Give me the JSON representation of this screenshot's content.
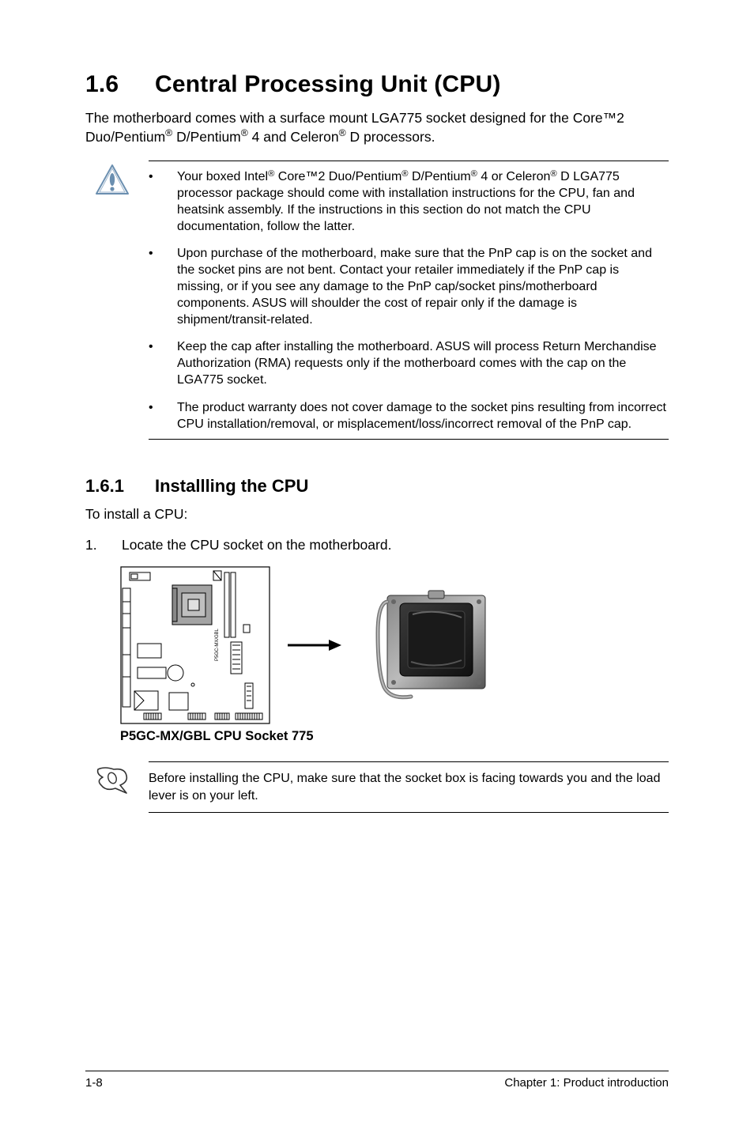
{
  "section": {
    "number": "1.6",
    "title": "Central Processing Unit (CPU)"
  },
  "intro_parts": {
    "p1": "The motherboard comes with a surface mount LGA775 socket designed for the Core™2 Duo/Pentium",
    "p2": " D/Pentium",
    "p3": " 4 and Celeron",
    "p4": " D processors."
  },
  "caution_bullets": [
    {
      "t1": "Your boxed Intel",
      "t2": " Core™2 Duo/Pentium",
      "t3": " D/Pentium",
      "t4": " 4 or Celeron",
      "t5": " D LGA775 processor package should come with installation instructions for the CPU, fan and heatsink assembly. If the instructions in this section do not match the CPU documentation, follow the latter."
    },
    {
      "plain": "Upon purchase of the motherboard, make sure that the PnP cap is on the socket and the socket pins are not bent. Contact your retailer immediately if the PnP cap is missing, or if you see any damage to the PnP cap/socket pins/motherboard components. ASUS will shoulder the cost of repair only if the damage is shipment/transit-related."
    },
    {
      "plain": "Keep the cap after installing the motherboard. ASUS will process Return Merchandise Authorization (RMA) requests only if the motherboard comes with the cap on the LGA775 socket."
    },
    {
      "plain": "The product warranty does not cover damage to the socket pins resulting from incorrect CPU installation/removal, or misplacement/loss/incorrect removal of the PnP cap."
    }
  ],
  "subsection": {
    "number": "1.6.1",
    "title": "Installling the CPU"
  },
  "sub_intro": "To install a CPU:",
  "step1": {
    "no": "1.",
    "text": "Locate the CPU socket on the motherboard."
  },
  "figure_caption": "P5GC-MX/GBL CPU Socket 775",
  "board_label": "P5GC-MX/GBL",
  "note_text": "Before installing the CPU, make sure that the socket box is facing towards you and the load lever is on your left.",
  "footer": {
    "left": "1-8",
    "right": "Chapter 1: Product introduction"
  },
  "icons": {
    "caution": "caution-icon",
    "note": "note-icon"
  },
  "colors": {
    "caution_outline": "#5b7fa0",
    "caution_fill": "#d9e4ee",
    "caution_stroke": "#2f4f6f"
  }
}
